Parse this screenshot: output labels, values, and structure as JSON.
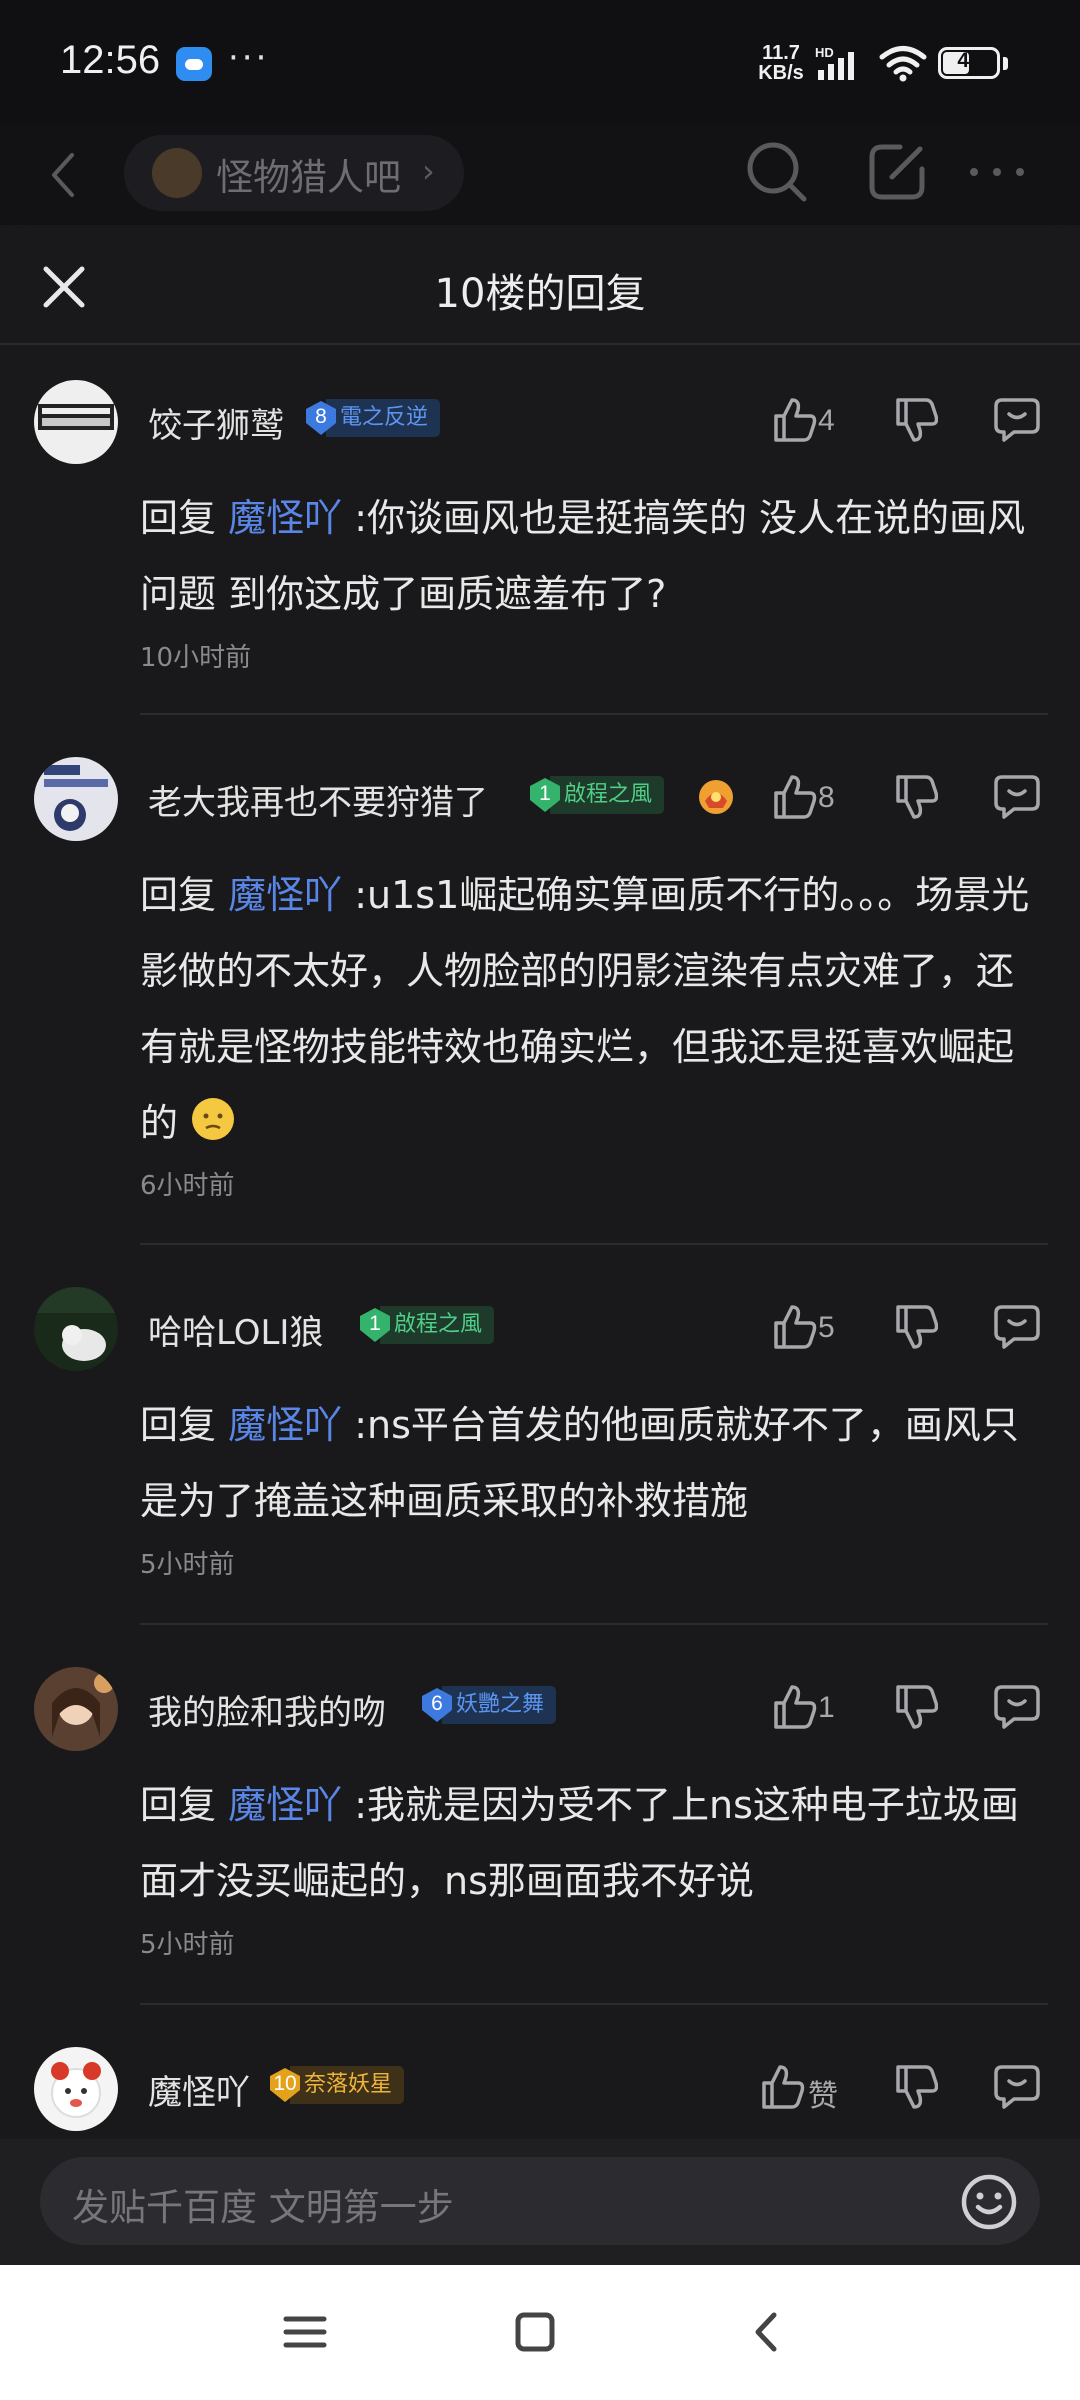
{
  "status_bar": {
    "time": "12:56",
    "dots": "···",
    "net_speed": "11.7",
    "net_unit": "KB/s",
    "hd": "HD",
    "battery": "46"
  },
  "forum_header": {
    "forum_name": "怪物猎人吧",
    "chevron": "›"
  },
  "sheet": {
    "title": "10楼的回复"
  },
  "comments": [
    {
      "name": "饺子狮鹫",
      "badge_level": "8",
      "badge_text": "電之反逆",
      "likes": "4",
      "reply_prefix": "回复",
      "mention": "魔怪吖",
      "text": ":你谈画风也是挺搞笑的 没人在说的画风问题 到你这成了画质遮羞布了?",
      "time": "10小时前"
    },
    {
      "name": "老大我再也不要狩猎了",
      "badge_level": "1",
      "badge_text": "啟程之風",
      "likes": "8",
      "reply_prefix": "回复",
      "mention": "魔怪吖",
      "text": ":u1s1崛起确实算画质不行的。。。场景光影做的不太好，人物脸部的阴影渲染有点灾难了，还有就是怪物技能特效也确实烂，但我还是挺喜欢崛起的",
      "time": "6小时前"
    },
    {
      "name": "哈哈LOLI狼",
      "badge_level": "1",
      "badge_text": "啟程之風",
      "likes": "5",
      "reply_prefix": "回复",
      "mention": "魔怪吖",
      "text": ":ns平台首发的他画质就好不了，画风只是为了掩盖这种画质采取的补救措施",
      "time": "5小时前"
    },
    {
      "name": "我的脸和我的吻",
      "badge_level": "6",
      "badge_text": "妖艷之舞",
      "likes": "1",
      "reply_prefix": "回复",
      "mention": "魔怪吖",
      "text": ":我就是因为受不了上ns这种电子垃圾画面才没买崛起的，ns那画面我不好说",
      "time": "5小时前"
    },
    {
      "name": "魔怪吖",
      "badge_level": "10",
      "badge_text": "奈落妖星",
      "likes": "赞"
    }
  ],
  "input": {
    "placeholder": "发贴千百度 文明第一步"
  },
  "colors": {
    "background": "#19191b",
    "mention": "#5a86e8",
    "badge_blue": "#3d7ae0",
    "badge_green": "#33b36b",
    "badge_gold": "#e3a21a"
  }
}
